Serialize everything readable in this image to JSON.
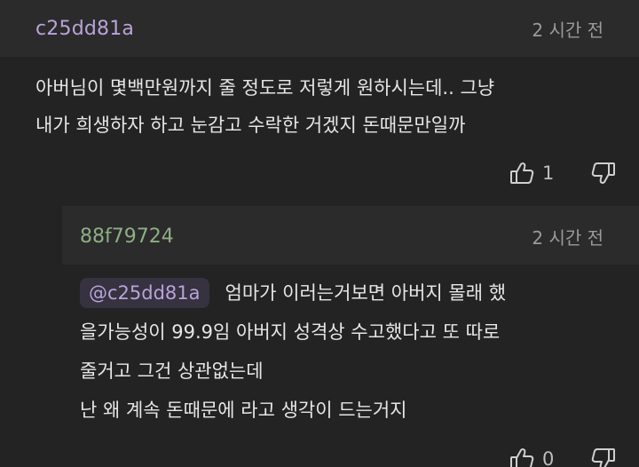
{
  "top_comment": {
    "author": "c25dd81a",
    "time": "2 시간 전",
    "lines": [
      "아버님이 몇백만원까지 줄 정도로 저렇게 원하시는데.. 그냥",
      "내가 희생하자 하고 눈감고 수락한 거겠지 돈때문만일까"
    ],
    "likes": "1"
  },
  "reply": {
    "author": "88f79724",
    "time": "2 시간 전",
    "mention": "@c25dd81a",
    "first_line_rest": "엄마가 이러는거보면 아버지 몰래 했",
    "lines": [
      "을가능성이 99.9임 아버지 성격상 수고했다고 또 따로",
      "줄거고 그건 상관없는데",
      "난 왜 계속 돈때문에 라고 생각이 드는거지"
    ],
    "likes": "0"
  },
  "icons": {
    "like": "thumbs-up-outline-icon",
    "dislike": "thumbs-down-outline-icon"
  }
}
